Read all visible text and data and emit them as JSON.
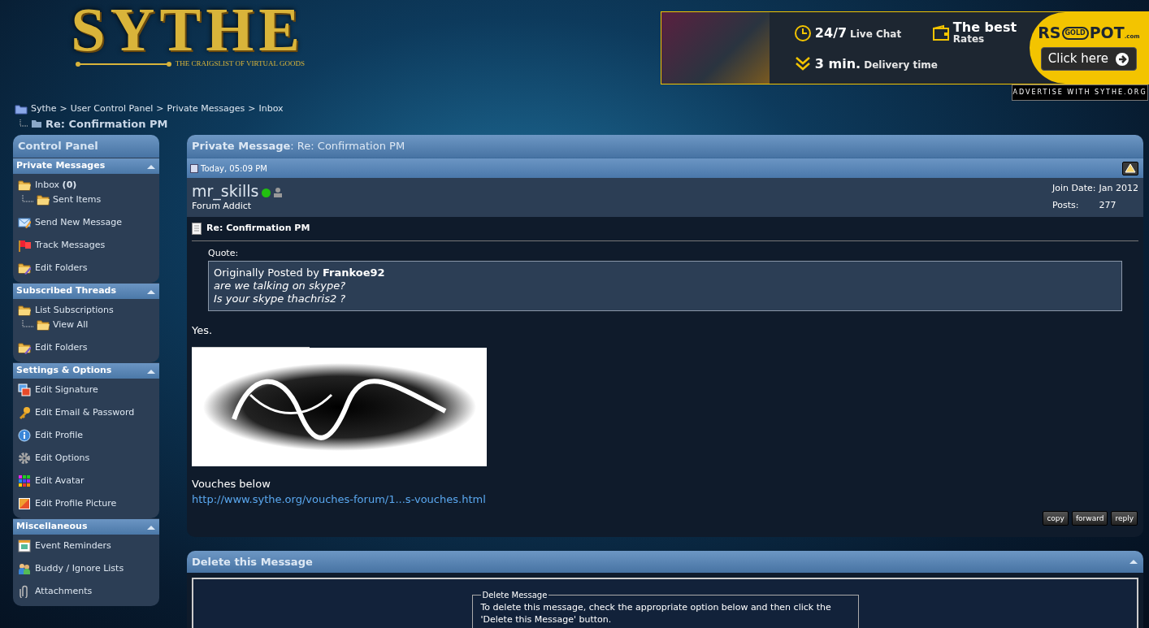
{
  "logo": {
    "wordmark": "SYTHE",
    "tagline": "THE CRAIGSLIST OF VIRTUAL GOODS"
  },
  "ad": {
    "feature_1": {
      "strong": "24/7",
      "text": "Live Chat"
    },
    "feature_2": {
      "strong": "The best",
      "text": "Rates"
    },
    "feature_3": {
      "strong": "3 min.",
      "text": "Delivery time"
    },
    "brand": {
      "left": "RS",
      "badge": "GOLD",
      "right": "POT",
      "suffix": ".com"
    },
    "button": "Click here",
    "advertise": "ADVERTISE WITH SYTHE.ORG"
  },
  "breadcrumb": {
    "items": [
      "Sythe",
      "User Control Panel",
      "Private Messages",
      "Inbox"
    ],
    "separator": ">",
    "current": "Re: Confirmation PM"
  },
  "sidebar": {
    "title": "Control Panel",
    "sections": [
      {
        "title": "Private Messages",
        "expanded": true,
        "items": [
          {
            "label": "Inbox **(0)**",
            "children": [
              {
                "label": "Sent Items"
              }
            ]
          },
          {
            "label": "Send New Message"
          },
          {
            "label": "Track Messages"
          },
          {
            "label": "Edit Folders"
          }
        ]
      },
      {
        "title": "Subscribed Threads",
        "expanded": true,
        "items": [
          {
            "label": "List Subscriptions",
            "children": [
              {
                "label": "View All"
              }
            ]
          },
          {
            "label": "Edit Folders"
          }
        ]
      },
      {
        "title": "Settings & Options",
        "expanded": true,
        "items": [
          {
            "label": "Edit Signature"
          },
          {
            "label": "Edit Email & Password"
          },
          {
            "label": "Edit Profile"
          },
          {
            "label": "Edit Options"
          },
          {
            "label": "Edit Avatar"
          },
          {
            "label": "Edit Profile Picture"
          }
        ]
      },
      {
        "title": "Miscellaneous",
        "expanded": true,
        "items": [
          {
            "label": "Event Reminders"
          },
          {
            "label": "Buddy / Ignore Lists"
          },
          {
            "label": "Attachments"
          }
        ]
      }
    ]
  },
  "message": {
    "title": "**Private Message**: Re: Confirmation PM",
    "date": "Today, 05:09 PM",
    "user": {
      "name": "mr_skills",
      "online": true,
      "rank": "Forum Addict",
      "join_label": "Join Date:",
      "join_value": "Jan 2012",
      "posts_label": "Posts:",
      "posts_value": "277"
    },
    "subject": "Re: Confirmation PM",
    "quote": {
      "label": "Quote:",
      "byline": "Originally Posted by **Frankoe92**",
      "lines": [
        "are we talking on skype?",
        "Is your skype thachris2 ?"
      ]
    },
    "body": "Yes.",
    "after_signature": "Vouches below",
    "link": "http://www.sythe.org/vouches-forum/1...s-vouches.html",
    "buttons": [
      "copy",
      "forward",
      "reply"
    ]
  },
  "delete": {
    "title": "Delete this Message",
    "expanded": true,
    "legend": "Delete Message",
    "text": "To delete this message, check the appropriate option below and then click the 'Delete this Message' button."
  }
}
